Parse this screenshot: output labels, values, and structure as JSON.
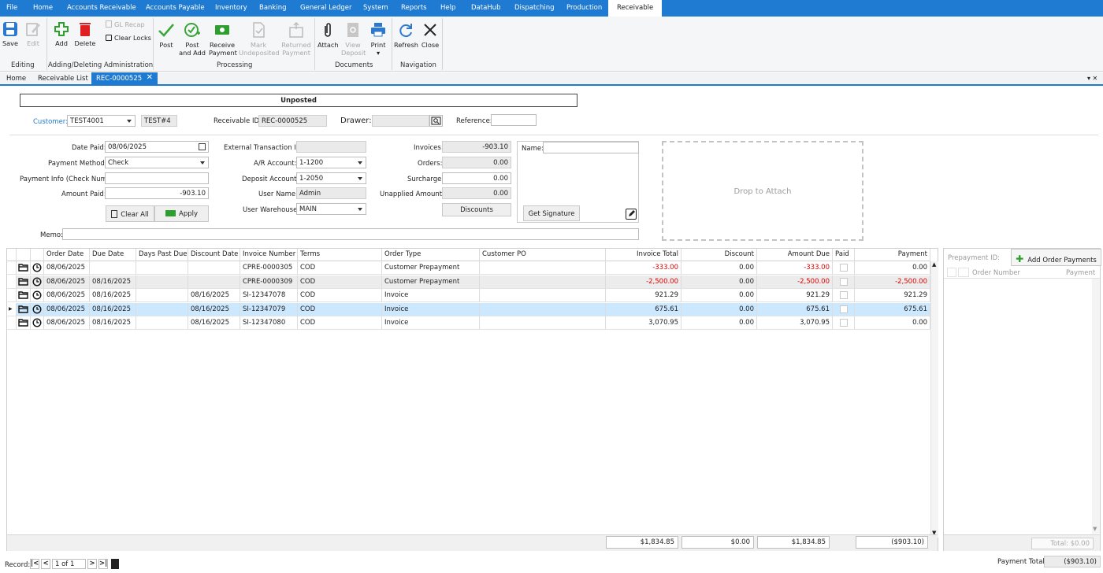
{
  "menu": [
    "File",
    "Home",
    "Accounts Receivable",
    "Accounts Payable",
    "Inventory",
    "Banking",
    "General Ledger",
    "System",
    "Reports",
    "Help",
    "DataHub",
    "Dispatching",
    "Production",
    "Receivable"
  ],
  "ribbon": {
    "save": "Save",
    "edit": "Edit",
    "add": "Add",
    "delete": "Delete",
    "gl_recap": "GL Recap",
    "clear_locks": "Clear Locks",
    "post": "Post",
    "post_add_1": "Post",
    "post_add_2": "and Add",
    "receive_1": "Receive",
    "receive_2": "Payment",
    "mark_1": "Mark",
    "mark_2": "Undeposited",
    "returned_1": "Returned",
    "returned_2": "Payment",
    "attach": "Attach",
    "view_1": "View",
    "view_2": "Deposit",
    "print": "Print",
    "refresh": "Refresh",
    "close": "Close",
    "groups": {
      "editing": "Editing",
      "adding": "Adding/Deleting",
      "admin": "Administration",
      "processing": "Processing",
      "documents": "Documents",
      "navigation": "Navigation"
    }
  },
  "tabs": [
    "Home",
    "Receivable List",
    "REC-0000525"
  ],
  "status": "Unposted",
  "header": {
    "customer_label": "Customer:",
    "customer": "TEST4001",
    "customer_name": "TEST#4",
    "rid_label": "Receivable ID:",
    "rid": "REC-0000525",
    "drawer_label": "Drawer:",
    "drawer": "",
    "ref_label": "Reference:",
    "ref": ""
  },
  "form": {
    "date_paid_label": "Date Paid:",
    "date_paid": "08/06/2025",
    "method_label": "Payment Method:",
    "method": "Check",
    "info_label": "Payment Info (Check Num):",
    "info": "",
    "amount_label": "Amount Paid:",
    "amount": "-903.10",
    "clear_all": "Clear All",
    "apply": "Apply",
    "ext_label": "External Transaction ID:",
    "ext": "",
    "ar_label": "A/R Account:",
    "ar": "1-1200",
    "dep_label": "Deposit Account:",
    "dep": "1-2050",
    "user_label": "User Name:",
    "user": "Admin",
    "wh_label": "User Warehouse:",
    "wh": "MAIN",
    "inv_label": "Invoices:",
    "inv": "-903.10",
    "ord_label": "Orders:",
    "ord": "0.00",
    "sur_label": "Surcharge:",
    "sur": "0.00",
    "unap_label": "Unapplied Amount:",
    "unap": "0.00",
    "discounts": "Discounts",
    "name_label": "Name:",
    "name": "",
    "get_signature": "Get Signature",
    "drop": "Drop to Attach",
    "memo_label": "Memo:",
    "memo": ""
  },
  "grid": {
    "headers": [
      "Order Date",
      "Due Date",
      "Days Past Due",
      "Discount Date",
      "Invoice Number",
      "Terms",
      "Order Type",
      "Customer PO",
      "Invoice Total",
      "Discount",
      "Amount Due",
      "Paid",
      "Payment"
    ],
    "rows": [
      [
        "08/06/2025",
        "",
        "",
        "",
        "CPRE-0000305",
        "COD",
        "Customer Prepayment",
        "",
        "-333.00",
        "0.00",
        "-333.00",
        "",
        "0.00"
      ],
      [
        "08/06/2025",
        "08/16/2025",
        "",
        "",
        "CPRE-0000309",
        "COD",
        "Customer Prepayment",
        "",
        "-2,500.00",
        "0.00",
        "-2,500.00",
        "",
        "-2,500.00"
      ],
      [
        "08/06/2025",
        "08/16/2025",
        "",
        "08/16/2025",
        "SI-12347078",
        "COD",
        "Invoice",
        "",
        "921.29",
        "0.00",
        "921.29",
        "",
        "921.29"
      ],
      [
        "08/06/2025",
        "08/16/2025",
        "",
        "08/16/2025",
        "SI-12347079",
        "COD",
        "Invoice",
        "",
        "675.61",
        "0.00",
        "675.61",
        "",
        "675.61"
      ],
      [
        "08/06/2025",
        "08/16/2025",
        "",
        "08/16/2025",
        "SI-12347080",
        "COD",
        "Invoice",
        "",
        "3,070.95",
        "0.00",
        "3,070.95",
        "",
        "0.00"
      ]
    ],
    "totals": {
      "invoice_total": "$1,834.85",
      "discount": "$0.00",
      "amount_due": "$1,834.85",
      "payment": "($903.10)"
    }
  },
  "prepay": {
    "id_label": "Prepayment ID:",
    "add_btn": "Add Order Payments",
    "col_order": "Order Number",
    "col_payment": "Payment",
    "total": "Total: $0.00"
  },
  "footer": {
    "record_label": "Record:",
    "record": "1 of 1",
    "pt_label": "Payment Total:",
    "pt": "($903.10)"
  },
  "colors": {
    "accent": "#1f7ad1",
    "selected_row": "#cce8ff",
    "negative": "#e00000"
  }
}
